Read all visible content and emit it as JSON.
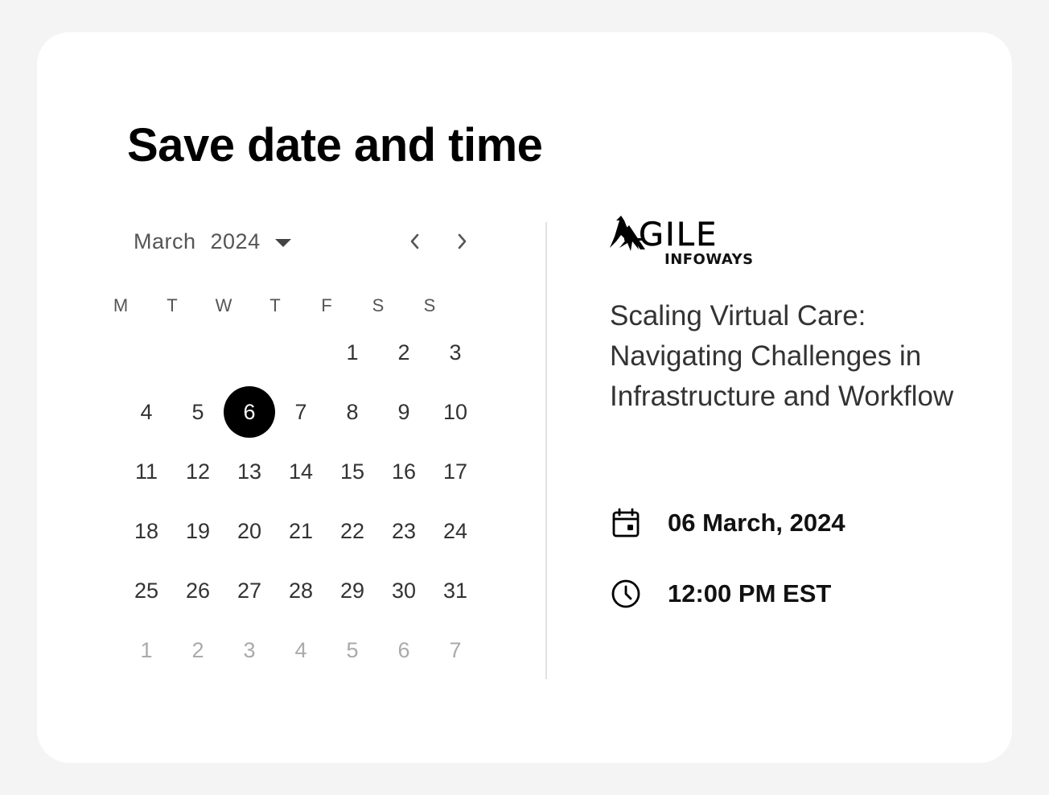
{
  "title": "Save date and time",
  "calendar": {
    "month": "March",
    "year": "2024",
    "weekdays": [
      "M",
      "T",
      "W",
      "T",
      "F",
      "S",
      "S"
    ],
    "weeks": [
      [
        {
          "d": ""
        },
        {
          "d": ""
        },
        {
          "d": ""
        },
        {
          "d": ""
        },
        {
          "d": "1"
        },
        {
          "d": "2"
        },
        {
          "d": "3"
        }
      ],
      [
        {
          "d": "4"
        },
        {
          "d": "5"
        },
        {
          "d": "6",
          "selected": true
        },
        {
          "d": "7"
        },
        {
          "d": "8"
        },
        {
          "d": "9"
        },
        {
          "d": "10"
        }
      ],
      [
        {
          "d": "11"
        },
        {
          "d": "12"
        },
        {
          "d": "13"
        },
        {
          "d": "14"
        },
        {
          "d": "15"
        },
        {
          "d": "16"
        },
        {
          "d": "17"
        }
      ],
      [
        {
          "d": "18"
        },
        {
          "d": "19"
        },
        {
          "d": "20"
        },
        {
          "d": "21"
        },
        {
          "d": "22"
        },
        {
          "d": "23"
        },
        {
          "d": "24"
        }
      ],
      [
        {
          "d": "25"
        },
        {
          "d": "26"
        },
        {
          "d": "27"
        },
        {
          "d": "28"
        },
        {
          "d": "29"
        },
        {
          "d": "30"
        },
        {
          "d": "31"
        }
      ],
      [
        {
          "d": "1",
          "muted": true
        },
        {
          "d": "2",
          "muted": true
        },
        {
          "d": "3",
          "muted": true
        },
        {
          "d": "4",
          "muted": true
        },
        {
          "d": "5",
          "muted": true
        },
        {
          "d": "6",
          "muted": true
        },
        {
          "d": "7",
          "muted": true
        }
      ]
    ],
    "icons": {
      "dropdown": "chevron-down-icon",
      "prev": "chevron-left-icon",
      "next": "chevron-right-icon"
    }
  },
  "event": {
    "logo_text": "GILE",
    "logo_subtext": "INFOWAYS",
    "title": "Scaling Virtual Care: Navigating Challenges in Infrastructure and Workflow",
    "date": "06 March, 2024",
    "time": "12:00 PM EST",
    "icons": {
      "date": "calendar-icon",
      "time": "clock-icon"
    }
  },
  "colors": {
    "background": "#f4f4f4",
    "card": "#ffffff",
    "selected_day": "#000000",
    "muted_day": "#aaaaaa",
    "divider": "#e2e2e2"
  }
}
